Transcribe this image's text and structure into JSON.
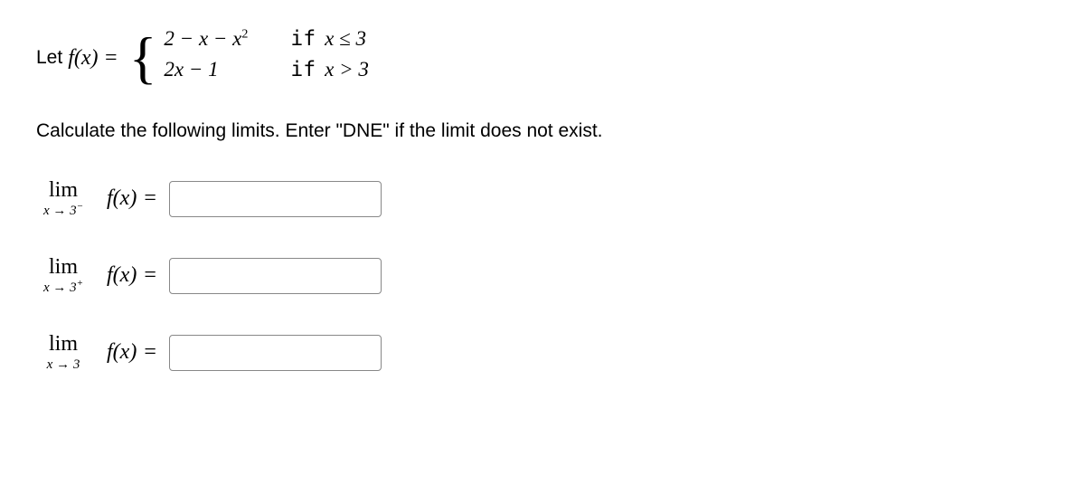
{
  "definition": {
    "let": "Let ",
    "fx": "f(x) = ",
    "piece1_expr": "2 − x − x",
    "piece1_sup": "2",
    "piece1_if": "if",
    "piece1_cond": "x ≤ 3",
    "piece2_expr": "2x − 1",
    "piece2_if": "if",
    "piece2_cond": "x > 3"
  },
  "instruction": "Calculate the following limits. Enter \"DNE\" if the limit does not exist.",
  "limits": {
    "lim_label": "lim",
    "row1_sub": "x → 3",
    "row1_sup": "−",
    "row2_sub": "x → 3",
    "row2_sup": "+",
    "row3_sub": "x → 3",
    "row3_sup": "",
    "fx": "f(x)",
    "equals": "="
  },
  "inputs": {
    "v1": "",
    "v2": "",
    "v3": ""
  }
}
